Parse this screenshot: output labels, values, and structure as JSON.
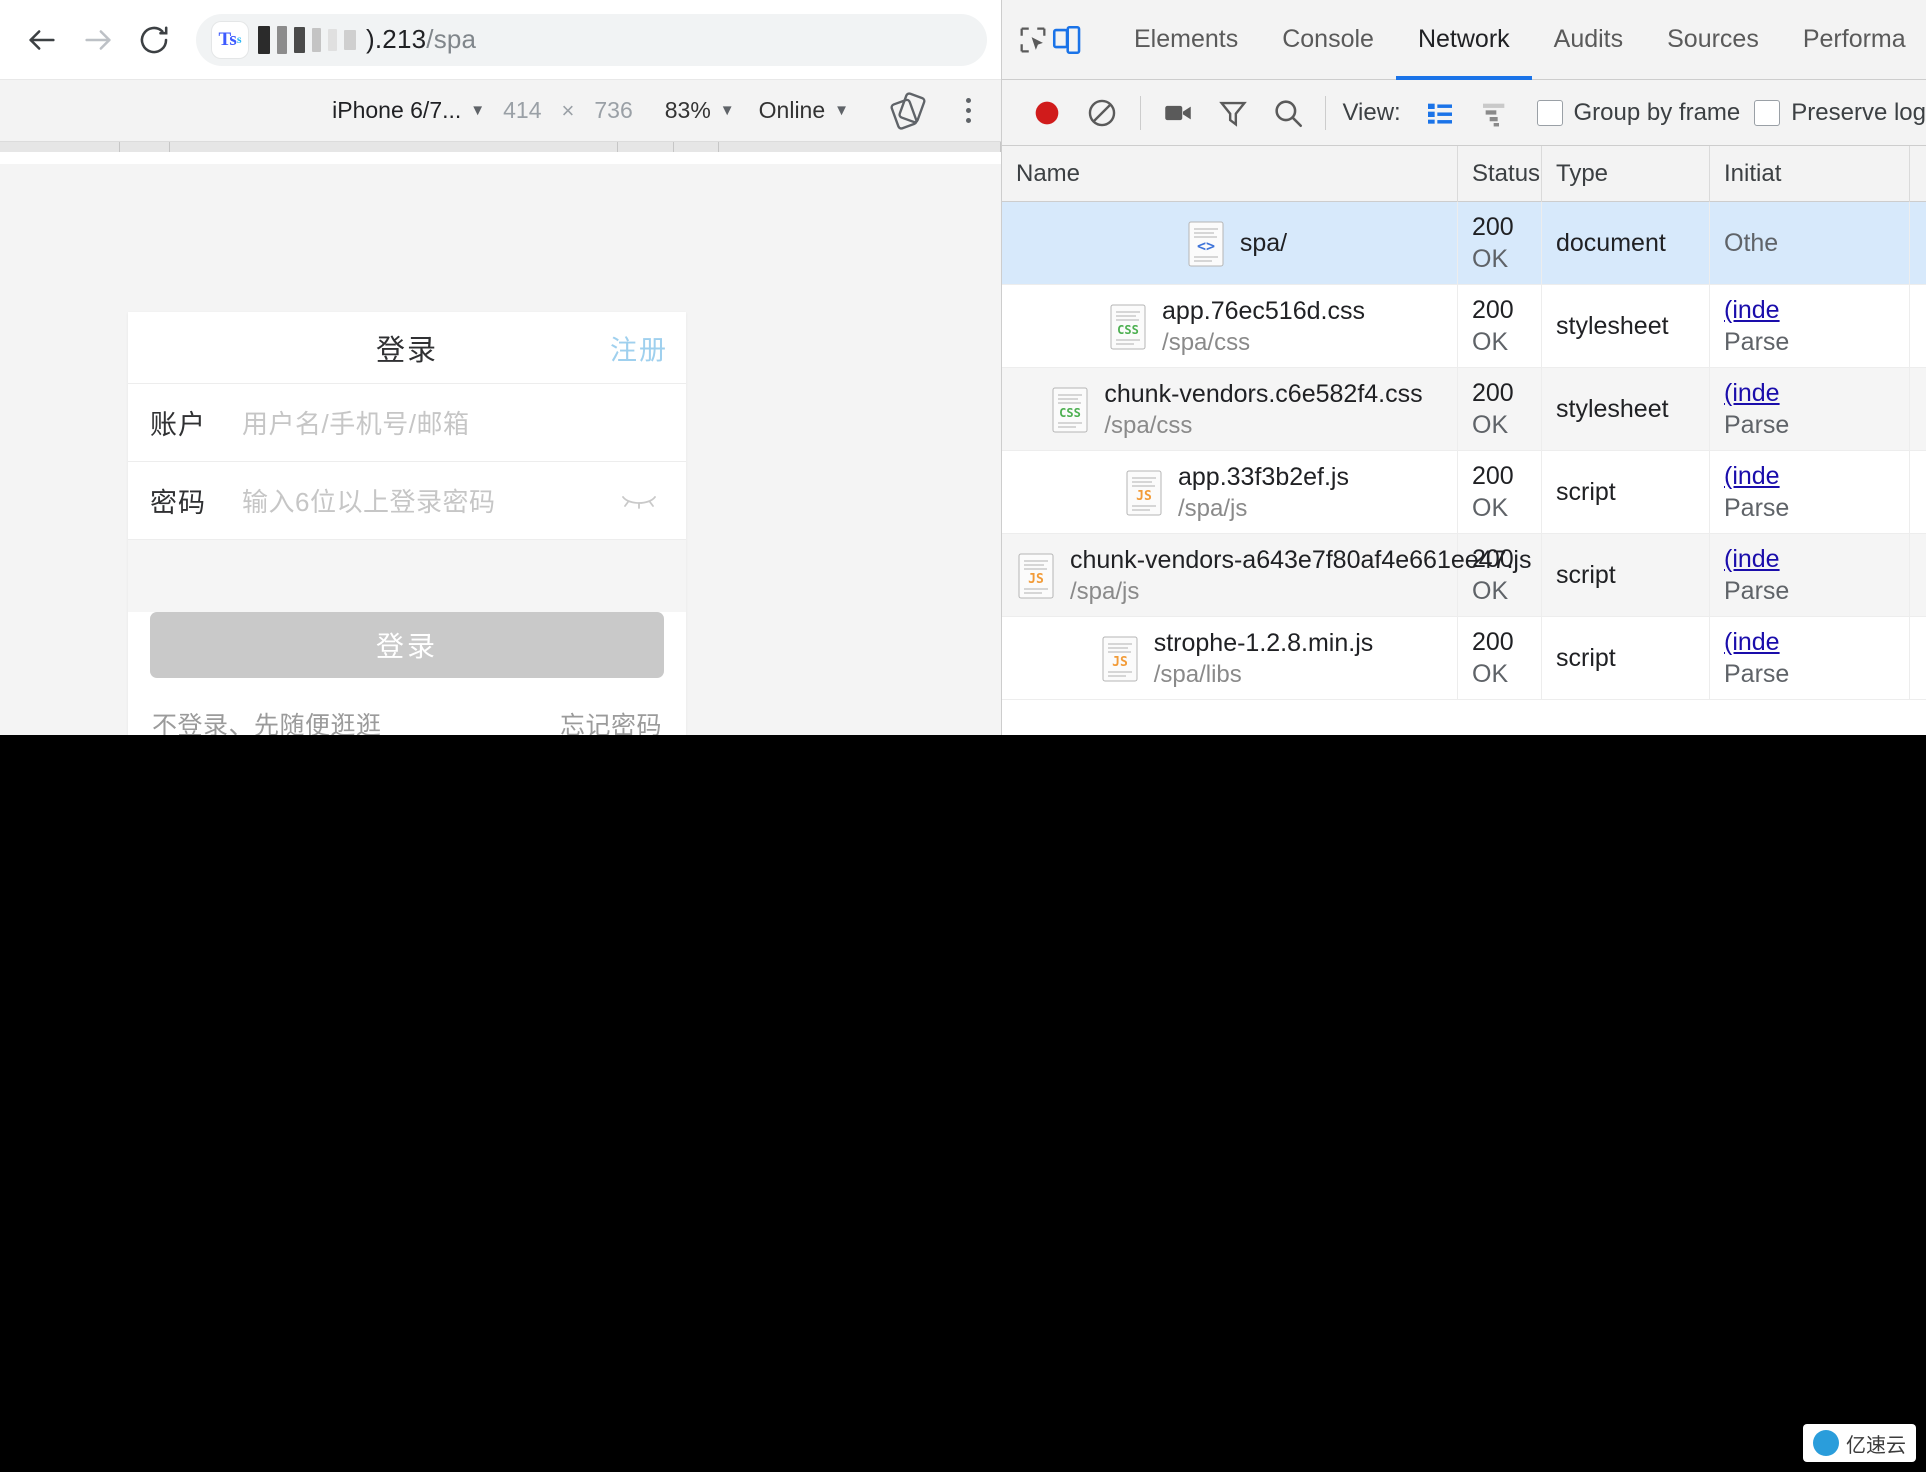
{
  "browser": {
    "back_icon": "arrow-left-icon",
    "forward_icon": "arrow-right-icon",
    "reload_icon": "reload-icon",
    "site_badge": "Ts",
    "site_badge_sub": "s",
    "url_visible": ").213",
    "url_path": "/spa",
    "redacted": true
  },
  "device_bar": {
    "device": "iPhone 6/7...",
    "width": "414",
    "times": "×",
    "height": "736",
    "zoom": "83%",
    "throttling": "Online",
    "rotate_icon": "rotate-icon",
    "more_icon": "kebab-menu-icon"
  },
  "page": {
    "card": {
      "title": "登录",
      "register": "注册",
      "fields": [
        {
          "label": "账户",
          "placeholder": "用户名/手机号/邮箱",
          "type": "text"
        },
        {
          "label": "密码",
          "placeholder": "输入6位以上登录密码",
          "type": "password"
        }
      ],
      "submit": "登录",
      "footer_left": "不登录、先随便逛逛",
      "footer_right": "忘记密码"
    }
  },
  "devtools": {
    "inspect_icon": "inspect-cursor-icon",
    "device_toggle_icon": "device-toolbar-icon",
    "tabs": [
      {
        "label": "Elements",
        "active": false
      },
      {
        "label": "Console",
        "active": false
      },
      {
        "label": "Network",
        "active": true
      },
      {
        "label": "Audits",
        "active": false
      },
      {
        "label": "Sources",
        "active": false
      },
      {
        "label": "Performa",
        "active": false
      }
    ],
    "toolbar": {
      "record_icon": "record-button-icon",
      "clear_icon": "clear-icon",
      "camera_icon": "camera-icon",
      "filter_icon": "filter-funnel-icon",
      "search_icon": "search-icon",
      "view_label": "View:",
      "view_list_icon": "list-view-icon",
      "view_waterfall_icon": "waterfall-view-icon",
      "group_by_frame": "Group by frame",
      "preserve_log": "Preserve log"
    },
    "columns": [
      "Name",
      "Status",
      "Type",
      "Initiat"
    ],
    "requests": [
      {
        "name": "spa/",
        "path": "",
        "status": "200",
        "status_text": "OK",
        "type": "document",
        "initiator": "Othe",
        "initiator_sub": "",
        "icon": "html-file-icon",
        "selected": true
      },
      {
        "name": "app.76ec516d.css",
        "path": "/spa/css",
        "status": "200",
        "status_text": "OK",
        "type": "stylesheet",
        "initiator": "(inde",
        "initiator_sub": "Parse",
        "icon": "css-file-icon",
        "selected": false
      },
      {
        "name": "chunk-vendors.c6e582f4.css",
        "path": "/spa/css",
        "status": "200",
        "status_text": "OK",
        "type": "stylesheet",
        "initiator": "(inde",
        "initiator_sub": "Parse",
        "icon": "css-file-icon",
        "selected": false
      },
      {
        "name": "app.33f3b2ef.js",
        "path": "/spa/js",
        "status": "200",
        "status_text": "OK",
        "type": "script",
        "initiator": "(inde",
        "initiator_sub": "Parse",
        "icon": "js-file-icon",
        "selected": false
      },
      {
        "name": "chunk-vendors-a643e7f80af4e661ee47.js",
        "path": "/spa/js",
        "status": "200",
        "status_text": "OK",
        "type": "script",
        "initiator": "(inde",
        "initiator_sub": "Parse",
        "icon": "js-file-icon",
        "selected": false
      },
      {
        "name": "strophe-1.2.8.min.js",
        "path": "/spa/libs",
        "status": "200",
        "status_text": "OK",
        "type": "script",
        "initiator": "(inde",
        "initiator_sub": "Parse",
        "icon": "js-file-icon",
        "selected": false
      }
    ]
  },
  "watermark": {
    "text": "亿速云"
  },
  "colors": {
    "accent": "#1a73e8",
    "selected_row": "#d7e9fb",
    "record": "#d01b1b",
    "link": "#1a0dab"
  }
}
